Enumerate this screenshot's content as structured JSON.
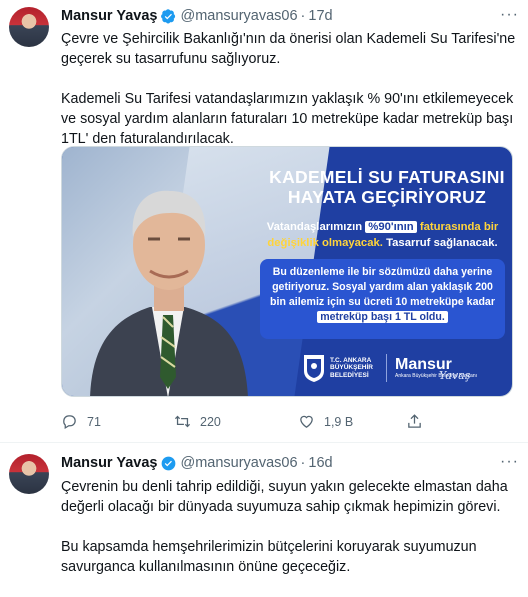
{
  "tweets": [
    {
      "name": "Mansur Yavaş",
      "handle": "@mansuryavas06",
      "dot": "·",
      "time": "17d",
      "paragraphs": [
        "Çevre ve Şehircilik Bakanlığı'nın da önerisi olan Kademeli Su Tarifesi'ne geçerek su tasarrufunu sağlıyoruz.",
        "Kademeli Su Tarifesi vatandaşlarımızın yaklaşık % 90'ını etkilemeyecek ve sosyal yardım alanların faturaları 10 metreküpe kadar metreküp başı 1TL' den faturalandırılacak."
      ],
      "media": {
        "title_line1": "KADEMELİ SU FATURASINI",
        "title_line2": "HAYATA GEÇİRİYORUZ",
        "box1_a": "Vatandaşlarımızın",
        "box1_hl": "%90'ının",
        "box1_b": "faturasında bir",
        "box1_c": "değişiklik olmayacak.",
        "box1_d": "Tasarruf sağlanacak.",
        "box2_a": "Bu düzenleme ile bir sözümüzü daha yerine getiriyoruz. Sosyal yardım alan yaklaşık 200 bin ailemiz için su ücreti 10 metreküpe kadar",
        "box2_hl": "metreküp başı 1 TL oldu.",
        "org": "T.C. ANKARA BÜYÜKŞEHİR BELEDİYESİ",
        "brand": "Mansur",
        "brand_sub": "Ankara Büyükşehir Belediye Başkanı",
        "signature": "Yavaş"
      },
      "actions": {
        "replies": "71",
        "retweets": "220",
        "likes": "1,9 B"
      }
    },
    {
      "name": "Mansur Yavaş",
      "handle": "@mansuryavas06",
      "dot": "·",
      "time": "16d",
      "paragraphs": [
        "Çevrenin bu denli tahrip edildiği, suyun yakın gelecekte elmastan daha değerli olacağı bir dünyada suyumuza sahip çıkmak hepimizin görevi.",
        "Bu kapsamda hemşehrilerimizin bütçelerini koruyarak suyumuzun savurganca kullanılmasının önüne geçeceğiz."
      ]
    }
  ],
  "more_label": "···",
  "colors": {
    "accent": "#1d9bf0",
    "banner_blue": "#1f3fa2",
    "text": "#0f1419",
    "muted": "#536471"
  },
  "icons": [
    "verified-badge-icon",
    "reply-icon",
    "retweet-icon",
    "like-icon",
    "share-icon",
    "more-icon"
  ]
}
